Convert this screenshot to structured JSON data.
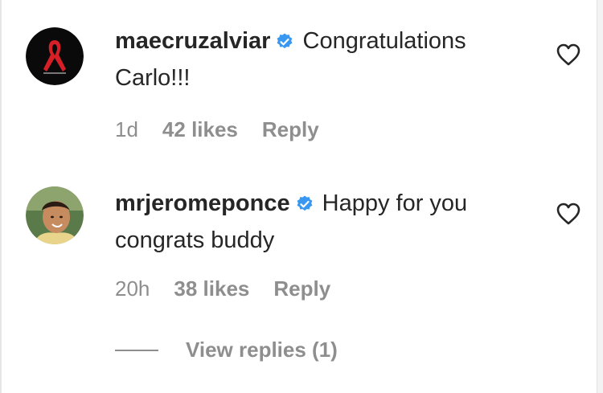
{
  "comments": [
    {
      "username": "maecruzalviar",
      "text": "Congratulations Carlo!!!",
      "time": "1d",
      "likes": "42 likes",
      "reply_label": "Reply",
      "avatar_icon": "red-ribbon-avatar",
      "verified_icon": "verified-badge-icon"
    },
    {
      "username": "mrjeromeponce",
      "text": "Happy for you congrats buddy",
      "time": "20h",
      "likes": "38 likes",
      "reply_label": "Reply",
      "avatar_icon": "profile-photo-avatar",
      "verified_icon": "verified-badge-icon"
    }
  ],
  "view_replies_label": "View replies (1)",
  "colors": {
    "text": "#262626",
    "secondary": "#8e8e8e",
    "verified": "#3897f0",
    "ribbon": "#d61f26"
  }
}
